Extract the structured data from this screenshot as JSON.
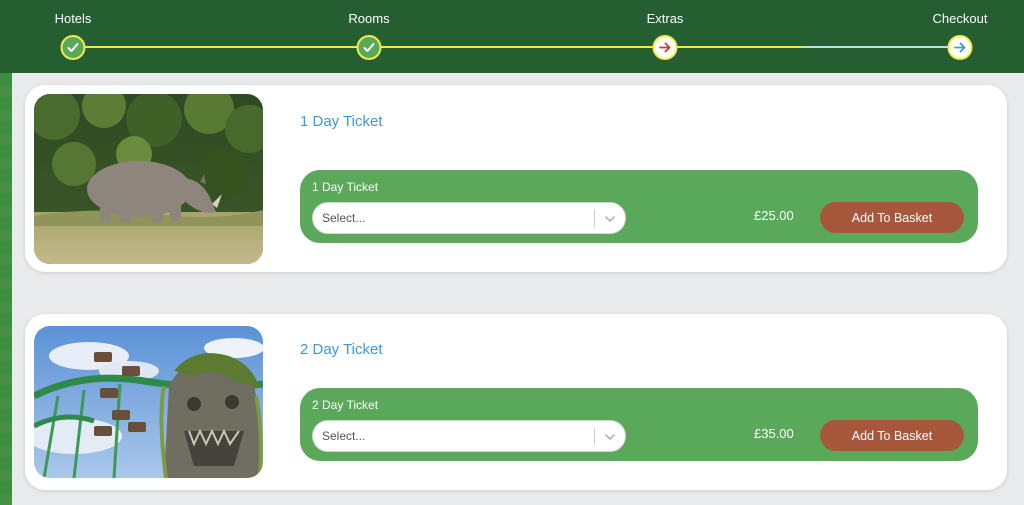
{
  "steps": [
    {
      "label": "Hotels",
      "state": "done"
    },
    {
      "label": "Rooms",
      "state": "done"
    },
    {
      "label": "Extras",
      "state": "current"
    },
    {
      "label": "Checkout",
      "state": "todo"
    }
  ],
  "colors": {
    "header_bg": "#245e31",
    "track_done": "#f1ea4d",
    "track_todo": "#c9d6ea",
    "accent_green": "#5aa95a",
    "title_blue": "#3a9ad9",
    "button_brown": "#a7573b",
    "current_arrow": "#d9342b",
    "todo_arrow": "#3a9ad9"
  },
  "tickets": [
    {
      "title": "1 Day Ticket",
      "option_label": "1 Day Ticket",
      "select_placeholder": "Select...",
      "price": "£25.00",
      "button_label": "Add To Basket",
      "image": "rhinoceros-photo"
    },
    {
      "title": "2 Day Ticket",
      "option_label": "2 Day Ticket",
      "select_placeholder": "Select...",
      "price": "£35.00",
      "button_label": "Add To Basket",
      "image": "rollercoaster-photo"
    }
  ],
  "icons": {
    "done": "check-icon",
    "current": "arrow-right-red-icon",
    "todo": "arrow-right-blue-icon",
    "select": "chevron-down-icon"
  }
}
